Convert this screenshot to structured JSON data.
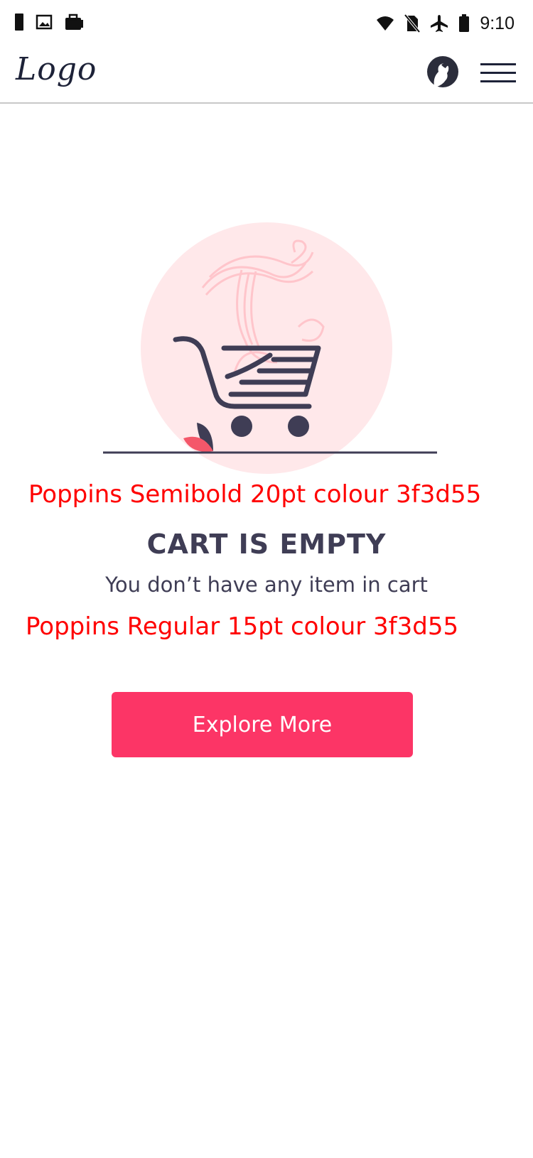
{
  "status_bar": {
    "time": "9:10",
    "left_icons": [
      "sim-card-icon",
      "image-icon",
      "briefcase-icon"
    ],
    "right_icons": [
      "wifi-icon",
      "no-sim-icon",
      "airplane-icon",
      "battery-icon"
    ]
  },
  "navbar": {
    "logo_text": "Logo",
    "avatar_icon": "profile-avatar-icon",
    "menu_icon": "hamburger-menu-icon"
  },
  "illustration": {
    "name": "empty-cart-illustration",
    "circle_color": "#ffe8ea",
    "cart_color": "#3f3d55",
    "accent_color": "#f4576a"
  },
  "notes": {
    "heading_spec": "Poppins Semibold 20pt colour 3f3d55",
    "body_spec": "Poppins Regular 15pt colour 3f3d55"
  },
  "empty_state": {
    "title": "CART IS EMPTY",
    "message": "You don’t have any item in cart"
  },
  "cta": {
    "label": "Explore More",
    "color": "#fc3566"
  }
}
